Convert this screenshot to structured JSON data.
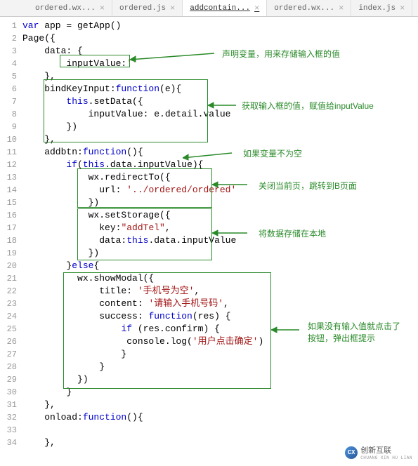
{
  "tabs": [
    {
      "label": "ordered.wx...",
      "active": false
    },
    {
      "label": "ordered.js",
      "active": false
    },
    {
      "label": "addcontain...",
      "active": true
    },
    {
      "label": "ordered.wx...",
      "active": false
    },
    {
      "label": "index.js",
      "active": false
    }
  ],
  "code": [
    "var app = getApp()",
    "Page({",
    "    data: {",
    "        inputValue:''",
    "    },",
    "    bindKeyInput:function(e){",
    "        this.setData({",
    "            inputValue: e.detail.value",
    "        })",
    "    },",
    "    addbtn:function(){",
    "        if(this.data.inputValue){",
    "            wx.redirectTo({",
    "              url: '../ordered/ordered'",
    "            })",
    "            wx.setStorage({",
    "              key:\"addTel\",",
    "              data:this.data.inputValue",
    "            })",
    "        }else{",
    "          wx.showModal({",
    "              title: '手机号为空',",
    "              content: '请输入手机号码',",
    "              success: function(res) {",
    "                  if (res.confirm) {",
    "                   console.log('用户点击确定')",
    "                  }",
    "              }",
    "          })",
    "        }",
    "    },",
    "    onload:function(){",
    "",
    "    },"
  ],
  "annotations": {
    "a1": "声明变量，用来存储输入框的值",
    "a2": "获取输入框的值，赋值给inputValue",
    "a3": "如果变量不为空",
    "a4": "关闭当前页，跳转到B页面",
    "a5": "将数据存储在本地",
    "a6_line1": "如果没有输入值就点击了",
    "a6_line2": "按钮，弹出框提示"
  },
  "watermark": {
    "brand": "创新互联",
    "sub": "CHUANG XIN HU LIAN"
  }
}
